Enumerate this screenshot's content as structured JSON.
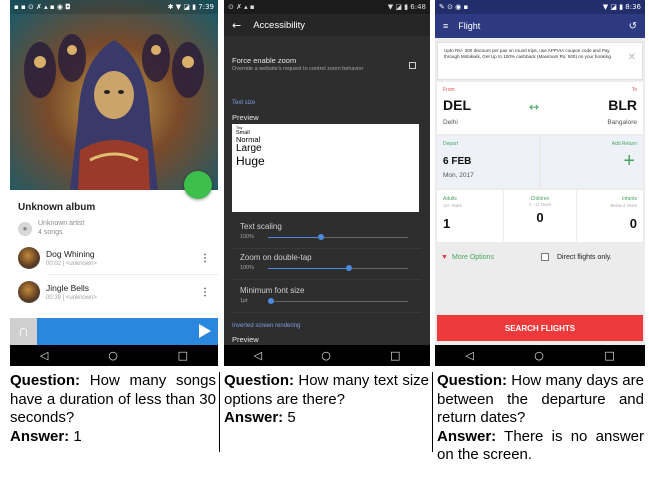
{
  "panel1": {
    "status": {
      "left": "▪ ▪ ⊙ ✗ ▴ ▪ ◉ ◘",
      "right": "✱ ▼ ◪ ▮ 7:39"
    },
    "album": "Unknown album",
    "artist": "Unknown artist",
    "song_count": "4 songs",
    "songs": [
      {
        "title": "Dog Whining",
        "sub": "00:02 | <unknown>"
      },
      {
        "title": "Jingle Bells",
        "sub": "00:39 | <unknown>"
      }
    ],
    "qa": {
      "q_label": "Question:",
      "q": "How many songs have a duration of less than 30 seconds?",
      "a_label": "Answer:",
      "a": "1"
    }
  },
  "panel2": {
    "status": {
      "left": "⊙ ✗ ▴ ▪",
      "right": "▼ ◪ ▮ 6:48"
    },
    "title": "Accessibility",
    "force_zoom": "Force enable zoom",
    "force_zoom_sub": "Override a website's request to control zoom behavior",
    "text_size_section": "Text size",
    "preview": "Preview",
    "preview_items": [
      "Tiny",
      "Small",
      "Normal",
      "Large",
      "Huge"
    ],
    "sliders": [
      {
        "label": "Text scaling",
        "value": "100%",
        "level": 0.38
      },
      {
        "label": "Zoom on double-tap",
        "value": "100%",
        "level": 0.58
      },
      {
        "label": "Minimum font size",
        "value": "1pt",
        "level": 0.02
      }
    ],
    "inverted_section": "Inverted screen rendering",
    "preview2": "Preview",
    "qa": {
      "q_label": "Question:",
      "q": "How many text size options are there?",
      "a_label": "Answer:",
      "a": "5"
    }
  },
  "panel3": {
    "status": {
      "left": "✎ ⊙ ◉ ▪",
      "right": "▼ ◪ ▮ 8:36"
    },
    "title": "Flight",
    "banner": "Upto Rs/- 300 discount per pax on round trips, use APPVIA coupon code and Pay through Mobikwik, Get Up to 100% cashback (Maximum Rs. 500) on your booking.",
    "from_label": "From",
    "to_label": "To",
    "from_code": "DEL",
    "to_code": "BLR",
    "from_city": "Delhi",
    "to_city": "Bangalore",
    "swap": "↔",
    "depart_label": "Depart",
    "depart_date": "6 FEB",
    "depart_day": "Mon, 2017",
    "return_label": "Add Return",
    "plus": "+",
    "adults": {
      "label": "Adults",
      "sub": "12+ Years",
      "count": "1"
    },
    "children": {
      "label": "Children",
      "sub": "2 - 11 Years",
      "count": "0"
    },
    "infants": {
      "label": "Infants",
      "sub": "Below 2 Years",
      "count": "0"
    },
    "more_options": "More Options",
    "direct": "Direct flights only.",
    "search": "SEARCH FLIGHTS",
    "qa": {
      "q_label": "Question:",
      "q": "How many days are between the departure and return dates?",
      "a_label": "Answer:",
      "a": "There is no answer on the screen."
    }
  },
  "nav": {
    "back": "◁",
    "home": "○",
    "recent": "□"
  }
}
